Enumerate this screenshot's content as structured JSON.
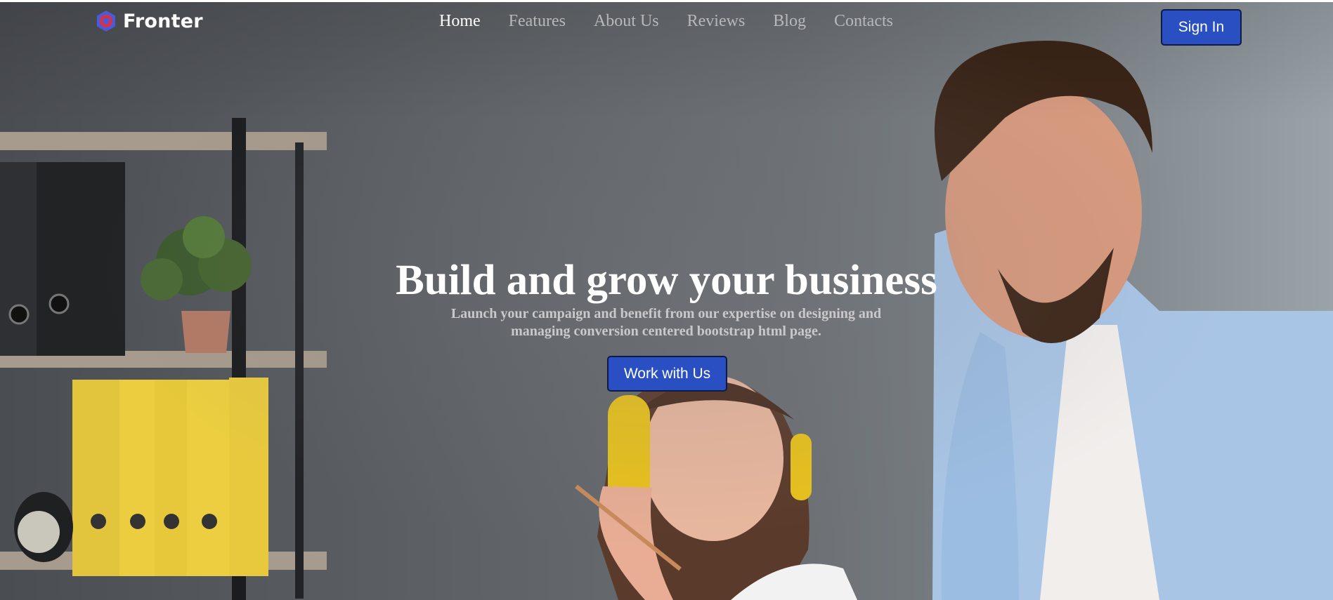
{
  "brand": {
    "name": "Fronter",
    "icon": "hexagon-ring-logo",
    "colors": {
      "outer": "#4b5bd6",
      "inner": "#d6314a"
    }
  },
  "nav": {
    "items": [
      {
        "label": "Home",
        "active": true
      },
      {
        "label": "Features",
        "active": false
      },
      {
        "label": "About Us",
        "active": false
      },
      {
        "label": "Reviews",
        "active": false
      },
      {
        "label": "Blog",
        "active": false
      },
      {
        "label": "Contacts",
        "active": false
      }
    ]
  },
  "header": {
    "signin_label": "Sign In"
  },
  "hero": {
    "title": "Build and grow your business",
    "subtitle_line1": "Launch your campaign and benefit from our expertise on designing and",
    "subtitle_line2": "managing conversion centered bootstrap html page.",
    "cta_label": "Work with Us"
  },
  "colors": {
    "accent": "#2a4fc3",
    "nav_active": "#ffffff",
    "nav_inactive": "#b7b8ba"
  }
}
